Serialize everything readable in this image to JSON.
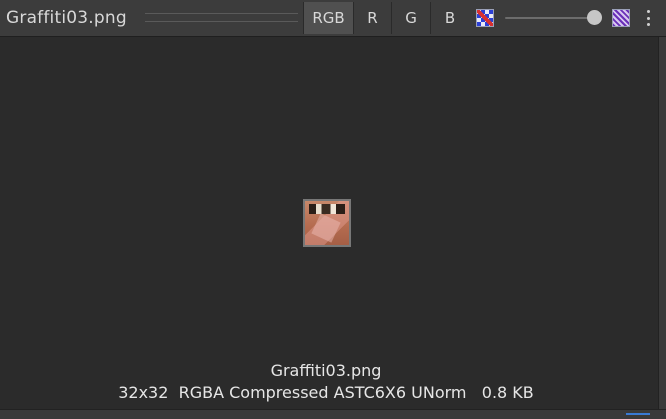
{
  "header": {
    "title": "Graffiti03.png",
    "channels": [
      {
        "label": "RGB",
        "active": true
      },
      {
        "label": "R",
        "active": false
      },
      {
        "label": "G",
        "active": false
      },
      {
        "label": "B",
        "active": false
      }
    ],
    "icons": {
      "alpha_toggle": "alpha-checker-icon",
      "mip_toggle": "mipmap-icon",
      "menu": "kebab-menu-icon"
    },
    "mip_slider_value": 1.0
  },
  "preview": {
    "file_name": "Graffiti03.png",
    "info": "32x32  RGBA Compressed ASTC6X6 UNorm   0.8 KB"
  },
  "colors": {
    "background": "#2b2b2b",
    "toolbar": "#3c3c3c",
    "active_button": "#505050",
    "text": "#d8d8d8"
  }
}
